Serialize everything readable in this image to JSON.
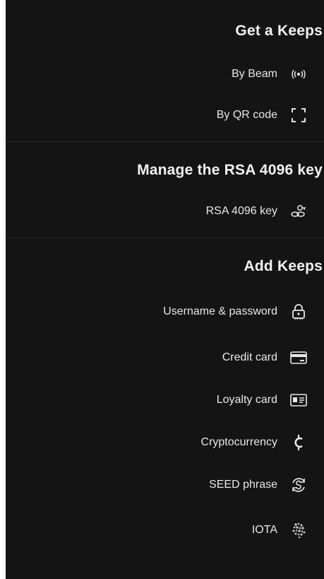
{
  "sections": {
    "get": {
      "title": "Get a Keeps",
      "items": [
        {
          "label": "By Beam",
          "icon": "beam-icon"
        },
        {
          "label": "By QR code",
          "icon": "qr-scan-icon"
        }
      ]
    },
    "manage": {
      "title": "Manage the RSA 4096 key",
      "items": [
        {
          "label": "RSA 4096 key",
          "icon": "key-link-icon"
        }
      ]
    },
    "add": {
      "title": "Add Keeps",
      "items": [
        {
          "label": "Username & password",
          "icon": "lock-icon"
        },
        {
          "label": "Credit card",
          "icon": "credit-card-icon"
        },
        {
          "label": "Loyalty card",
          "icon": "loyalty-card-icon"
        },
        {
          "label": "Cryptocurrency",
          "icon": "crypto-icon"
        },
        {
          "label": "SEED phrase",
          "icon": "seed-icon"
        },
        {
          "label": "IOTA",
          "icon": "iota-icon"
        }
      ]
    }
  },
  "colors": {
    "background": "#141414",
    "text": "#e6e6e6",
    "divider": "#2c2c2c"
  }
}
